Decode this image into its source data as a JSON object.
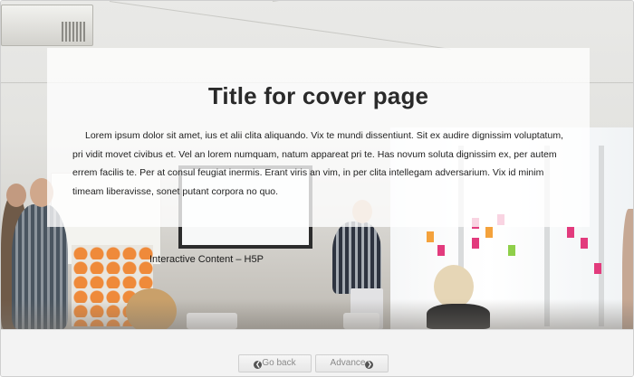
{
  "cover": {
    "title": "Title for cover page",
    "body": "Lorem ipsum dolor sit amet, ius et alii clita aliquando. Vix te mundi dissentiunt. Sit ex audire dignissim voluptatum, pri vidit movet civibus et. Vel an lorem numquam, natum appareat pri te. Has novum soluta dignissim ex, per autem errem facilis te. Per at consul feugiat inermis. Erant viris an vim, in per clita intellegam adversarium. Vix id minim timeam liberavisse, sonet putant corpora no quo.",
    "caption": "Interactive Content – H5P"
  },
  "nav": {
    "back_icon": "❮",
    "back_label": "Go back",
    "next_label": "Advance",
    "next_icon": "❯"
  },
  "colors": {
    "title": "#2a2a2a",
    "button_text": "#8a8a8a",
    "panel_overlay": "rgba(255,255,255,0.78)"
  }
}
